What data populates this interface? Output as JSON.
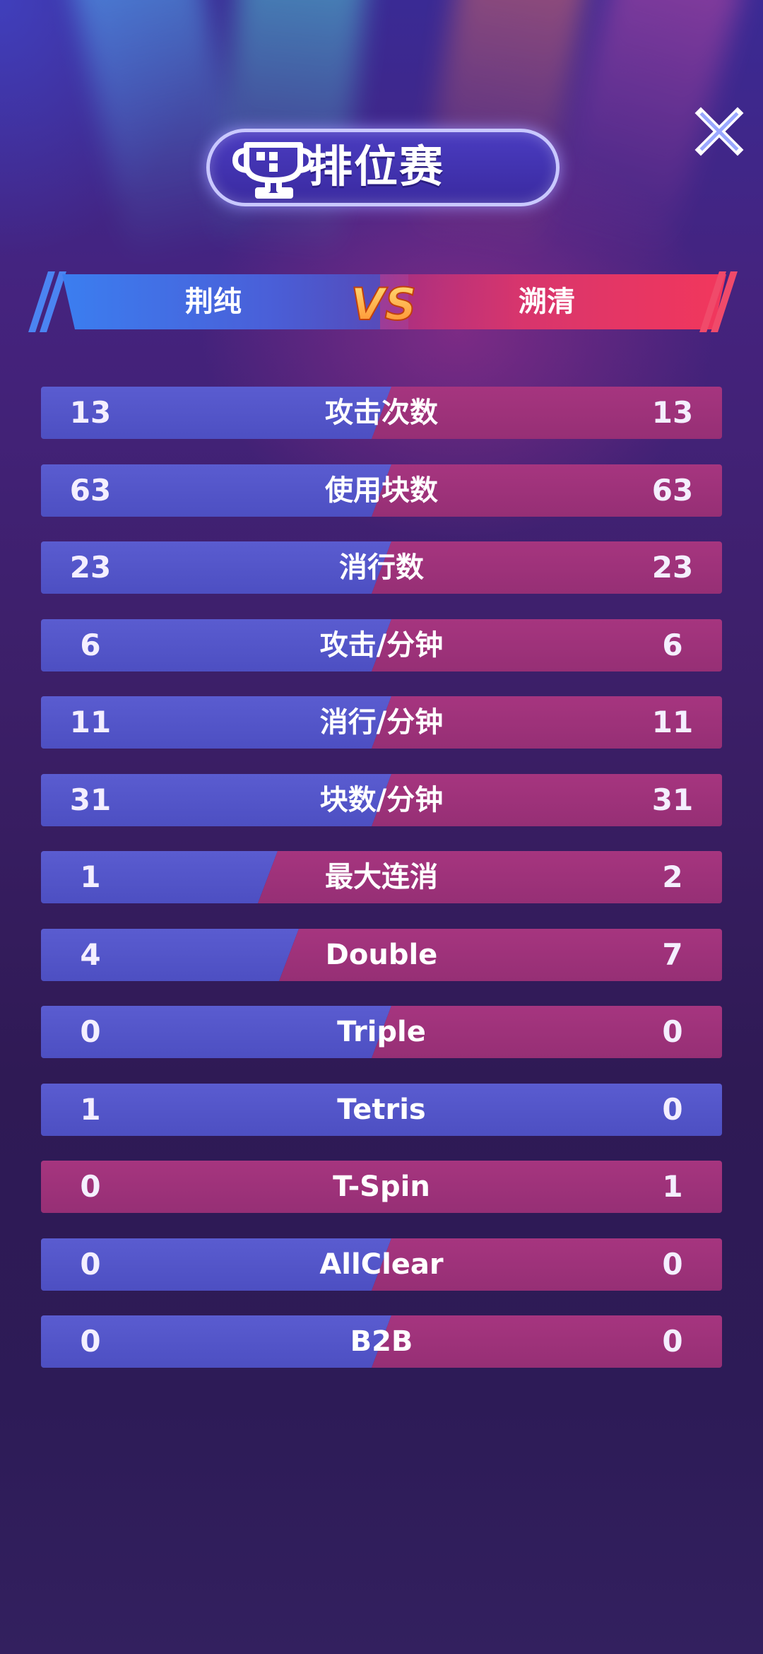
{
  "title": "排位赛",
  "players": {
    "left": "荆纯",
    "right": "溯清"
  },
  "vs_text": "VS",
  "colors": {
    "left": "#5558cc",
    "right": "#a3347e",
    "accent_blue": "#3b7ef0",
    "accent_red": "#f2375c"
  },
  "stats": [
    {
      "label": "攻击次数",
      "left": "13",
      "right": "13"
    },
    {
      "label": "使用块数",
      "left": "63",
      "right": "63"
    },
    {
      "label": "消行数",
      "left": "23",
      "right": "23"
    },
    {
      "label": "攻击/分钟",
      "left": "6",
      "right": "6"
    },
    {
      "label": "消行/分钟",
      "left": "11",
      "right": "11"
    },
    {
      "label": "块数/分钟",
      "left": "31",
      "right": "31"
    },
    {
      "label": "最大连消",
      "left": "1",
      "right": "2"
    },
    {
      "label": "Double",
      "left": "4",
      "right": "7"
    },
    {
      "label": "Triple",
      "left": "0",
      "right": "0"
    },
    {
      "label": "Tetris",
      "left": "1",
      "right": "0"
    },
    {
      "label": "T-Spin",
      "left": "0",
      "right": "1"
    },
    {
      "label": "AllClear",
      "left": "0",
      "right": "0"
    },
    {
      "label": "B2B",
      "left": "0",
      "right": "0"
    }
  ]
}
